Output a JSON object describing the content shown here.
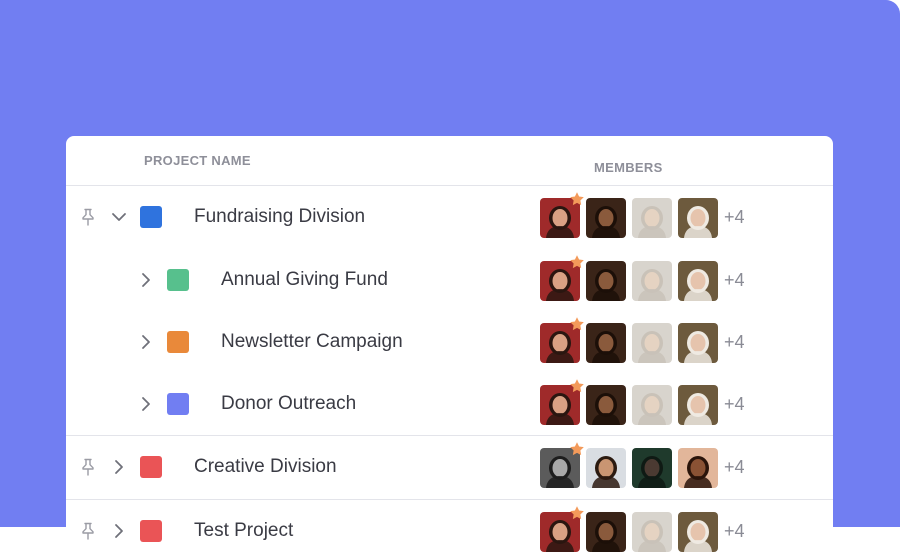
{
  "table": {
    "headers": {
      "project_name": "PROJECT NAME",
      "members": "MEMBERS"
    },
    "rows": [
      {
        "label": "Fundraising Division",
        "level": 0,
        "expanded": true,
        "pinned": true,
        "color": "#2f73de",
        "more": "+4",
        "avatars": [
          {
            "bg": "#9f2a2a",
            "skin": "#d9a184",
            "hair": "#2a1610",
            "starred": true
          },
          {
            "bg": "#3a2418",
            "skin": "#8a5a3c",
            "hair": "#1c0f08",
            "starred": false
          },
          {
            "bg": "#d8d4cd",
            "skin": "#e5d3c2",
            "hair": "#c9c2b8",
            "starred": false
          },
          {
            "bg": "#6d5a3d",
            "skin": "#e6c4ad",
            "hair": "#efeae2",
            "starred": false
          }
        ]
      },
      {
        "label": "Annual Giving Fund",
        "level": 1,
        "expanded": false,
        "pinned": false,
        "color": "#57c08d",
        "more": "+4",
        "avatars": [
          {
            "bg": "#9f2a2a",
            "skin": "#d9a184",
            "hair": "#2a1610",
            "starred": true
          },
          {
            "bg": "#3a2418",
            "skin": "#8a5a3c",
            "hair": "#1c0f08",
            "starred": false
          },
          {
            "bg": "#d8d4cd",
            "skin": "#e5d3c2",
            "hair": "#c9c2b8",
            "starred": false
          },
          {
            "bg": "#6d5a3d",
            "skin": "#e6c4ad",
            "hair": "#efeae2",
            "starred": false
          }
        ]
      },
      {
        "label": "Newsletter Campaign",
        "level": 1,
        "expanded": false,
        "pinned": false,
        "color": "#e9893a",
        "more": "+4",
        "avatars": [
          {
            "bg": "#9f2a2a",
            "skin": "#d9a184",
            "hair": "#2a1610",
            "starred": true
          },
          {
            "bg": "#3a2418",
            "skin": "#8a5a3c",
            "hair": "#1c0f08",
            "starred": false
          },
          {
            "bg": "#d8d4cd",
            "skin": "#e5d3c2",
            "hair": "#c9c2b8",
            "starred": false
          },
          {
            "bg": "#6d5a3d",
            "skin": "#e6c4ad",
            "hair": "#efeae2",
            "starred": false
          }
        ]
      },
      {
        "label": "Donor Outreach",
        "level": 1,
        "expanded": false,
        "pinned": false,
        "color": "#717ef2",
        "more": "+4",
        "avatars": [
          {
            "bg": "#9f2a2a",
            "skin": "#d9a184",
            "hair": "#2a1610",
            "starred": true
          },
          {
            "bg": "#3a2418",
            "skin": "#8a5a3c",
            "hair": "#1c0f08",
            "starred": false
          },
          {
            "bg": "#d8d4cd",
            "skin": "#e5d3c2",
            "hair": "#c9c2b8",
            "starred": false
          },
          {
            "bg": "#6d5a3d",
            "skin": "#e6c4ad",
            "hair": "#efeae2",
            "starred": false
          }
        ]
      },
      {
        "label": "Creative Division",
        "level": 0,
        "expanded": false,
        "pinned": true,
        "color": "#ea5456",
        "more": "+4",
        "avatars": [
          {
            "bg": "#5b5b5b",
            "skin": "#a8a8a8",
            "hair": "#1d1d1d",
            "starred": true
          },
          {
            "bg": "#d9dde2",
            "skin": "#c99572",
            "hair": "#2b1a10",
            "starred": false
          },
          {
            "bg": "#1f3a2c",
            "skin": "#4b3a32",
            "hair": "#0f1a14",
            "starred": false
          },
          {
            "bg": "#e2b69a",
            "skin": "#8a5234",
            "hair": "#2a140a",
            "starred": false
          }
        ]
      },
      {
        "label": "Test Project",
        "level": 0,
        "expanded": false,
        "pinned": true,
        "color": "#ea5456",
        "more": "+4",
        "avatars": [
          {
            "bg": "#9f2a2a",
            "skin": "#d9a184",
            "hair": "#2a1610",
            "starred": true
          },
          {
            "bg": "#3a2418",
            "skin": "#8a5a3c",
            "hair": "#1c0f08",
            "starred": false
          },
          {
            "bg": "#d8d4cd",
            "skin": "#e5d3c2",
            "hair": "#c9c2b8",
            "starred": false
          },
          {
            "bg": "#6d5a3d",
            "skin": "#e6c4ad",
            "hair": "#efeae2",
            "starred": false
          }
        ]
      }
    ]
  },
  "icons": {
    "pin": "pin-icon",
    "expand": "chevron-down-icon",
    "collapse": "chevron-right-icon",
    "star": "star-icon"
  },
  "colors": {
    "background": "#717ef2",
    "star": "#f39a5a"
  }
}
